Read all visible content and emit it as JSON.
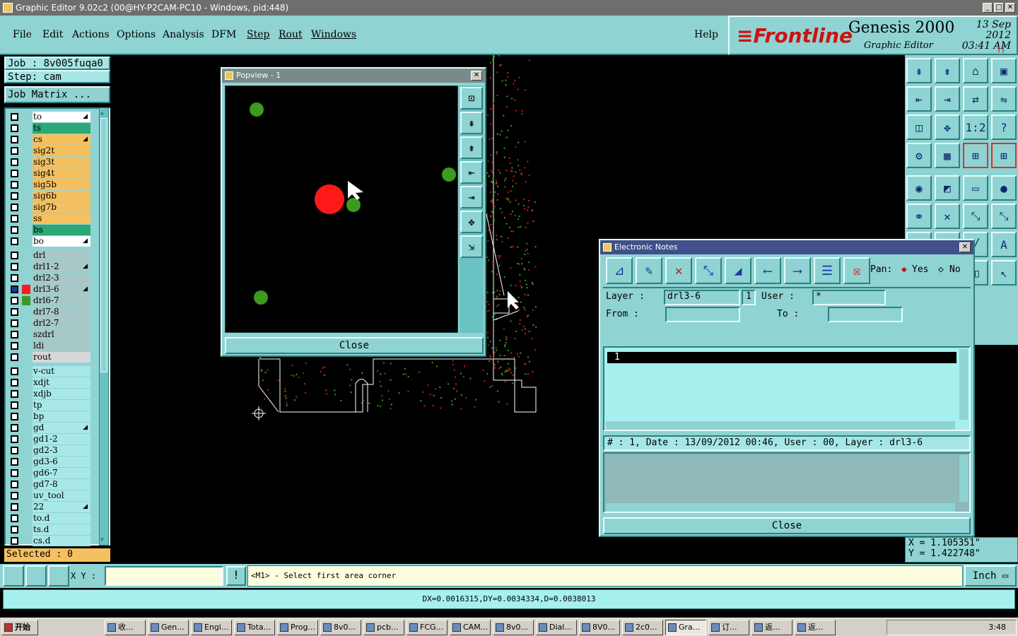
{
  "window": {
    "title": "Graphic Editor 9.02c2 (00@HY-P2CAM-PC10 - Windows, pid:448)"
  },
  "menu": [
    "File",
    "Edit",
    "Actions",
    "Options",
    "Analysis",
    "DFM",
    "Step",
    "Rout",
    "Windows"
  ],
  "help_label": "Help",
  "logo": {
    "brand": "Frontline",
    "product": "Genesis 2000",
    "subtitle": "Graphic Editor",
    "date_line1": "13  Sep  2012",
    "date_line2": "03:41  AM"
  },
  "job": {
    "job_line": "Job  :  8v005fuqa0",
    "step_line": "Step:  cam",
    "matrix_button": "Job Matrix  ..."
  },
  "layers": [
    {
      "name": "to",
      "color": "#ffffff",
      "arrow": true
    },
    {
      "name": "ts",
      "color": "#2aa876"
    },
    {
      "name": "cs",
      "color": "#f5c060",
      "arrow": true
    },
    {
      "name": "sig2t",
      "color": "#f5c060"
    },
    {
      "name": "sig3t",
      "color": "#f5c060"
    },
    {
      "name": "sig4t",
      "color": "#f5c060"
    },
    {
      "name": "sig5b",
      "color": "#f5c060"
    },
    {
      "name": "sig6b",
      "color": "#f5c060"
    },
    {
      "name": "sig7b",
      "color": "#f5c060"
    },
    {
      "name": "ss",
      "color": "#f5c060"
    },
    {
      "name": "bs",
      "color": "#2aa876"
    },
    {
      "name": "bo",
      "color": "#ffffff",
      "arrow": true
    },
    {
      "name": "drl",
      "color": "#a8c8c8",
      "gap": true
    },
    {
      "name": "drl1-2",
      "color": "#a8c8c8",
      "arrow": true
    },
    {
      "name": "drl2-3",
      "color": "#a8c8c8"
    },
    {
      "name": "drl3-6",
      "color": "#a8c8c8",
      "arrow": true,
      "swatch": "#ff1a1a",
      "checked": true
    },
    {
      "name": "drl6-7",
      "color": "#a8c8c8",
      "swatch": "#3c9a1e"
    },
    {
      "name": "drl7-8",
      "color": "#a8c8c8"
    },
    {
      "name": "drl2-7",
      "color": "#a8c8c8"
    },
    {
      "name": "szdrl",
      "color": "#a8c8c8"
    },
    {
      "name": "ldi",
      "color": "#a8c8c8"
    },
    {
      "name": "rout",
      "color": "#d8d8d8"
    },
    {
      "name": "v-cut",
      "color": "#a8e8e8",
      "gap": true
    },
    {
      "name": "xdjt",
      "color": "#a8e8e8"
    },
    {
      "name": "xdjb",
      "color": "#a8e8e8"
    },
    {
      "name": "tp",
      "color": "#a8e8e8"
    },
    {
      "name": "bp",
      "color": "#a8e8e8"
    },
    {
      "name": "gd",
      "color": "#a8e8e8",
      "arrow": true
    },
    {
      "name": "gd1-2",
      "color": "#a8e8e8"
    },
    {
      "name": "gd2-3",
      "color": "#a8e8e8"
    },
    {
      "name": "gd3-6",
      "color": "#a8e8e8"
    },
    {
      "name": "gd6-7",
      "color": "#a8e8e8"
    },
    {
      "name": "gd7-8",
      "color": "#a8e8e8"
    },
    {
      "name": "uv_tool",
      "color": "#a8e8e8"
    },
    {
      "name": "22",
      "color": "#a8e8e8",
      "arrow": true
    },
    {
      "name": "to.d",
      "color": "#a8e8e8"
    },
    {
      "name": "ts.d",
      "color": "#a8e8e8"
    },
    {
      "name": "cs.d",
      "color": "#a8e8e8"
    }
  ],
  "selected": "Selected  :  0",
  "popview": {
    "title": "Popview - 1",
    "close": "Close"
  },
  "enotes": {
    "title": "Electronic Notes",
    "pan_label": "Pan:",
    "pan_yes": "Yes",
    "pan_no": "No",
    "layer_label": "Layer  :",
    "layer_value": "drl3-6",
    "count": "1",
    "user_label": "User  :",
    "user_value": "*",
    "from_label": "From   :",
    "to_label": "To    :",
    "list_item": "1",
    "info": "#  :  1,  Date  :  13/09/2012  00:46,  User  :  00,  Layer  :  drl3-6",
    "close": "Close"
  },
  "coords": {
    "x": "X  =  1.105351\"",
    "y": "Y  =  1.422748\""
  },
  "xy_label": "X Y  :",
  "prompt": "<M1>  -  Select first area corner",
  "units": "Inch",
  "status": "DX=0.0016315,DY=0.0034334,D=0.0038013",
  "taskbar": {
    "start": "开始",
    "tasks": [
      "收...",
      "Gen...",
      "Engi...",
      "Tota...",
      "Prog...",
      "8v0...",
      "pcb...",
      "FCG...",
      "CAM...",
      "8v0...",
      "Dial...",
      "8V0...",
      "2c0...",
      "Gra...",
      "订...",
      "返...",
      "返..."
    ],
    "clock": "3:48"
  }
}
